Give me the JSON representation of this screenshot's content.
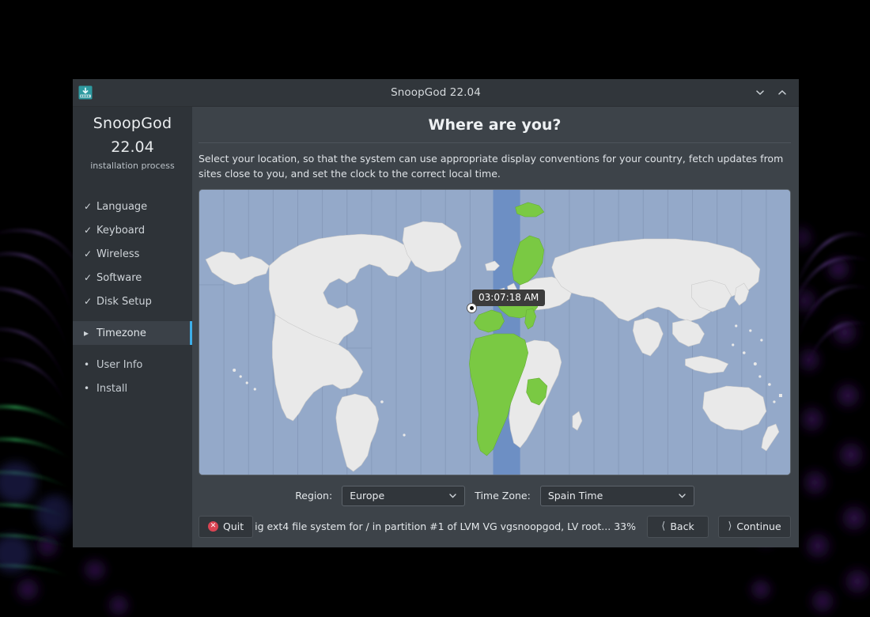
{
  "window": {
    "title": "SnoopGod 22.04",
    "app_icon": "installer-icon",
    "minimize_icon": "chevron-down-icon",
    "maximize_icon": "chevron-up-icon"
  },
  "sidebar": {
    "brand_name": "SnoopGod",
    "brand_version": "22.04",
    "brand_subtitle": "installation process",
    "steps": [
      {
        "label": "Language",
        "state": "done",
        "mark": "✓"
      },
      {
        "label": "Keyboard",
        "state": "done",
        "mark": "✓"
      },
      {
        "label": "Wireless",
        "state": "done",
        "mark": "✓"
      },
      {
        "label": "Software",
        "state": "done",
        "mark": "✓"
      },
      {
        "label": "Disk Setup",
        "state": "done",
        "mark": "✓"
      },
      {
        "label": "Timezone",
        "state": "active",
        "mark": "▸"
      },
      {
        "label": "User Info",
        "state": "pending",
        "mark": "•"
      },
      {
        "label": "Install",
        "state": "pending",
        "mark": "•"
      }
    ]
  },
  "main": {
    "page_title": "Where are you?",
    "description": "Select your location, so that the system can use appropriate display conventions for your country, fetch updates from sites close to you, and set the clock to the correct local time.",
    "map": {
      "tooltip_time": "03:07:18 AM",
      "marker_name": "location-marker",
      "ocean_color": "#94a9c9",
      "land_color": "#e8e8e8",
      "highlight_color": "#7ac943",
      "selected_band_color": "#6d8fc4"
    },
    "region": {
      "label": "Region:",
      "value": "Europe"
    },
    "timezone": {
      "label": "Time Zone:",
      "value": "Spain Time"
    }
  },
  "footer": {
    "quit_label": "Quit",
    "quit_icon": "error-circle-icon",
    "status": "ig ext4 file system for / in partition #1 of LVM VG vgsnoopgod, LV root... 33%",
    "back_label": "Back",
    "back_icon": "chevron-left-icon",
    "continue_label": "Continue",
    "continue_icon": "chevron-right-icon"
  },
  "theme": {
    "accent": "#3daee9",
    "window_bg": "#31363b",
    "content_bg": "#3d4349",
    "sidebar_bg": "#2e3338",
    "danger": "#da4453"
  }
}
